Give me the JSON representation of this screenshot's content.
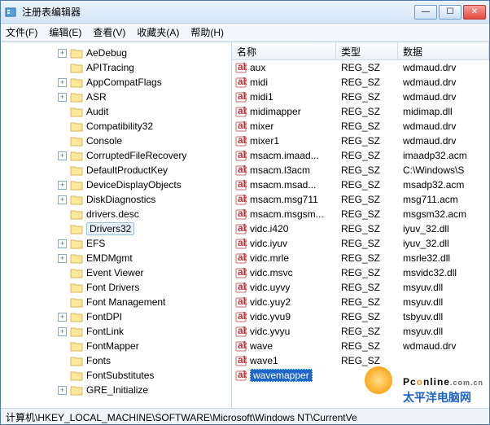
{
  "window": {
    "title": "注册表编辑器"
  },
  "menu": {
    "file": "文件(F)",
    "edit": "编辑(E)",
    "view": "查看(V)",
    "favorites": "收藏夹(A)",
    "help": "帮助(H)"
  },
  "tree": {
    "items": [
      {
        "label": "AeDebug",
        "exp": "+"
      },
      {
        "label": "APITracing",
        "exp": ""
      },
      {
        "label": "AppCompatFlags",
        "exp": "+"
      },
      {
        "label": "ASR",
        "exp": "+"
      },
      {
        "label": "Audit",
        "exp": ""
      },
      {
        "label": "Compatibility32",
        "exp": ""
      },
      {
        "label": "Console",
        "exp": ""
      },
      {
        "label": "CorruptedFileRecovery",
        "exp": "+"
      },
      {
        "label": "DefaultProductKey",
        "exp": ""
      },
      {
        "label": "DeviceDisplayObjects",
        "exp": "+"
      },
      {
        "label": "DiskDiagnostics",
        "exp": "+"
      },
      {
        "label": "drivers.desc",
        "exp": ""
      },
      {
        "label": "Drivers32",
        "exp": "",
        "sel": true
      },
      {
        "label": "EFS",
        "exp": "+"
      },
      {
        "label": "EMDMgmt",
        "exp": "+"
      },
      {
        "label": "Event Viewer",
        "exp": ""
      },
      {
        "label": "Font Drivers",
        "exp": ""
      },
      {
        "label": "Font Management",
        "exp": ""
      },
      {
        "label": "FontDPI",
        "exp": "+"
      },
      {
        "label": "FontLink",
        "exp": "+"
      },
      {
        "label": "FontMapper",
        "exp": ""
      },
      {
        "label": "Fonts",
        "exp": ""
      },
      {
        "label": "FontSubstitutes",
        "exp": ""
      },
      {
        "label": "GRE_Initialize",
        "exp": "+"
      }
    ]
  },
  "cols": {
    "name": "名称",
    "type": "类型",
    "data": "数据"
  },
  "rows": [
    {
      "n": "aux",
      "t": "REG_SZ",
      "d": "wdmaud.drv"
    },
    {
      "n": "midi",
      "t": "REG_SZ",
      "d": "wdmaud.drv"
    },
    {
      "n": "midi1",
      "t": "REG_SZ",
      "d": "wdmaud.drv"
    },
    {
      "n": "midimapper",
      "t": "REG_SZ",
      "d": "midimap.dll"
    },
    {
      "n": "mixer",
      "t": "REG_SZ",
      "d": "wdmaud.drv"
    },
    {
      "n": "mixer1",
      "t": "REG_SZ",
      "d": "wdmaud.drv"
    },
    {
      "n": "msacm.imaad...",
      "t": "REG_SZ",
      "d": "imaadp32.acm"
    },
    {
      "n": "msacm.l3acm",
      "t": "REG_SZ",
      "d": "C:\\Windows\\S"
    },
    {
      "n": "msacm.msad...",
      "t": "REG_SZ",
      "d": "msadp32.acm"
    },
    {
      "n": "msacm.msg711",
      "t": "REG_SZ",
      "d": "msg711.acm"
    },
    {
      "n": "msacm.msgsm...",
      "t": "REG_SZ",
      "d": "msgsm32.acm"
    },
    {
      "n": "vidc.i420",
      "t": "REG_SZ",
      "d": "iyuv_32.dll"
    },
    {
      "n": "vidc.iyuv",
      "t": "REG_SZ",
      "d": "iyuv_32.dll"
    },
    {
      "n": "vidc.mrle",
      "t": "REG_SZ",
      "d": "msrle32.dll"
    },
    {
      "n": "vidc.msvc",
      "t": "REG_SZ",
      "d": "msvidc32.dll"
    },
    {
      "n": "vidc.uyvy",
      "t": "REG_SZ",
      "d": "msyuv.dll"
    },
    {
      "n": "vidc.yuy2",
      "t": "REG_SZ",
      "d": "msyuv.dll"
    },
    {
      "n": "vidc.yvu9",
      "t": "REG_SZ",
      "d": "tsbyuv.dll"
    },
    {
      "n": "vidc.yvyu",
      "t": "REG_SZ",
      "d": "msyuv.dll"
    },
    {
      "n": "wave",
      "t": "REG_SZ",
      "d": "wdmaud.drv"
    },
    {
      "n": "wave1",
      "t": "REG_SZ",
      "d": ""
    },
    {
      "n": "wavemapper",
      "t": "",
      "d": "",
      "sel": true
    }
  ],
  "status": "计算机\\HKEY_LOCAL_MACHINE\\SOFTWARE\\Microsoft\\Windows NT\\CurrentVe",
  "watermark": {
    "brand1a": "Pc",
    "brand1b": "o",
    "brand1c": "nline",
    "suffix": ".com.cn",
    "brand2": "太平洋电脑网"
  }
}
